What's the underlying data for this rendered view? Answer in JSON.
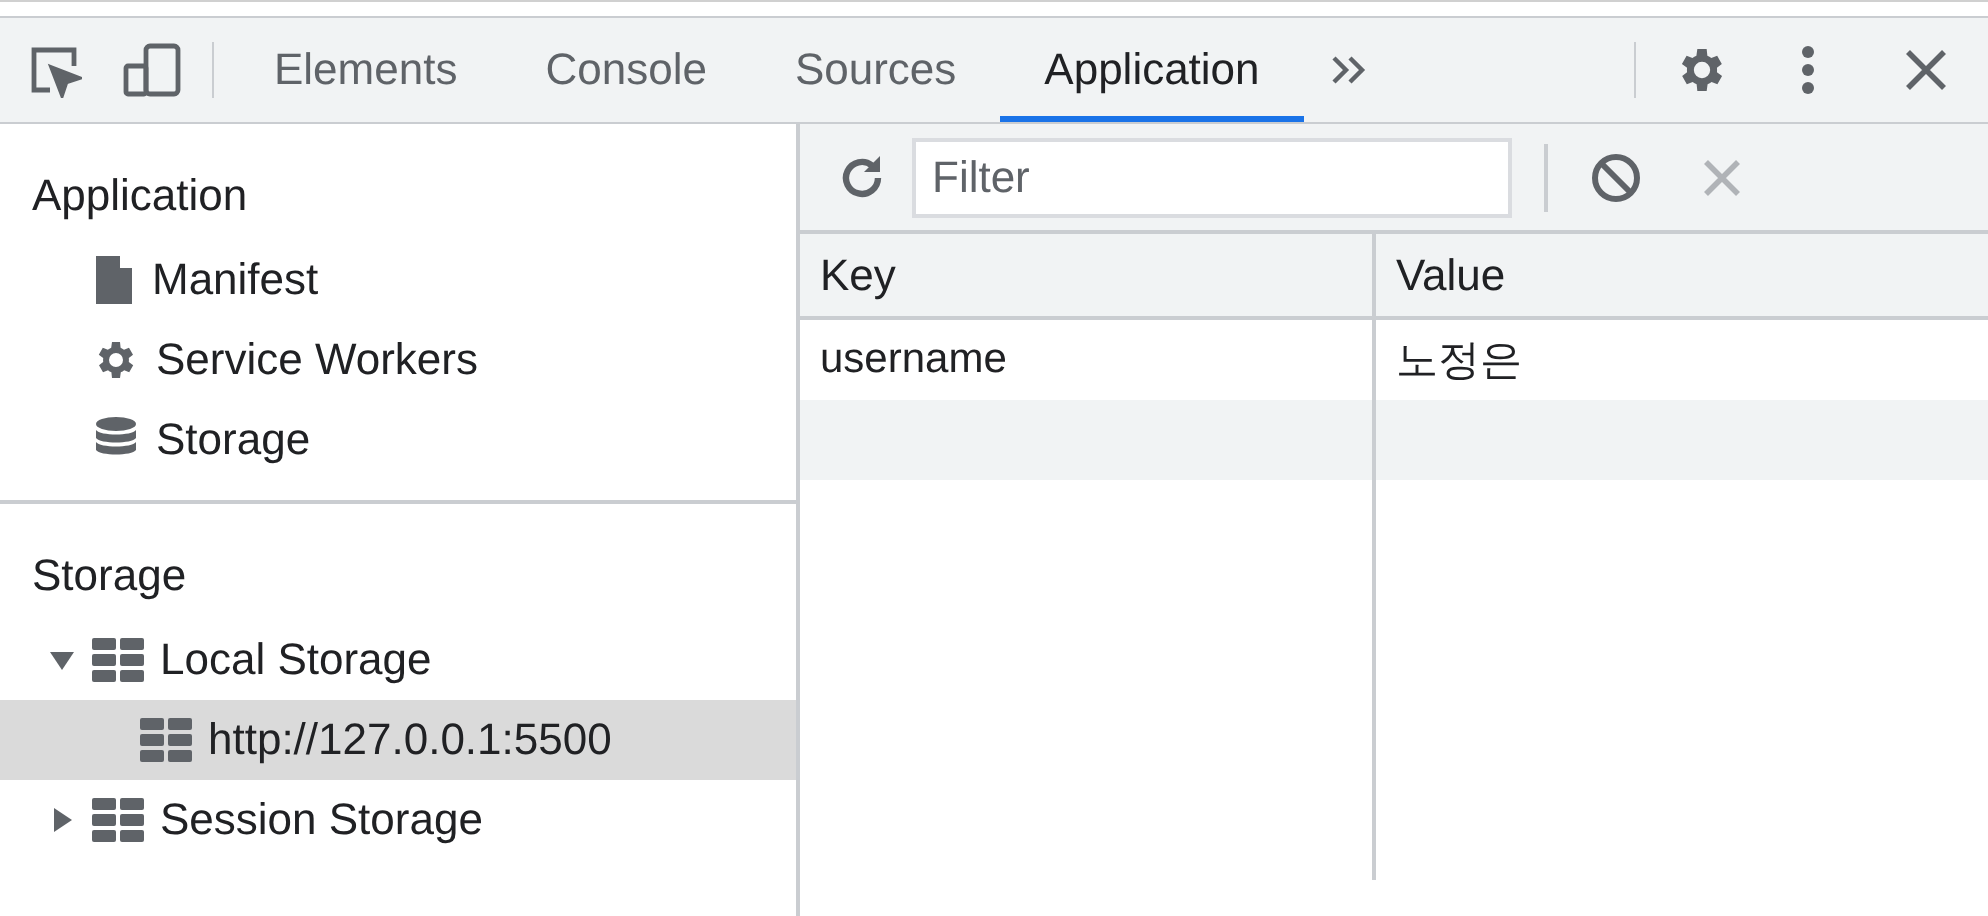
{
  "tabs": [
    {
      "label": "Elements",
      "selected": false
    },
    {
      "label": "Console",
      "selected": false
    },
    {
      "label": "Sources",
      "selected": false
    },
    {
      "label": "Application",
      "selected": true
    }
  ],
  "sidebar": {
    "sections": [
      {
        "title": "Application",
        "items": [
          {
            "label": "Manifest",
            "kind": "file",
            "selected": false
          },
          {
            "label": "Service Workers",
            "kind": "gear",
            "selected": false
          },
          {
            "label": "Storage",
            "kind": "database",
            "selected": false
          }
        ]
      },
      {
        "title": "Storage",
        "items": [
          {
            "label": "Local Storage",
            "kind": "grid",
            "selected": false,
            "expanded": true,
            "children": [
              {
                "label": "http://127.0.0.1:5500",
                "kind": "grid",
                "selected": true
              }
            ]
          },
          {
            "label": "Session Storage",
            "kind": "grid",
            "selected": false,
            "expanded": false
          }
        ]
      }
    ]
  },
  "filter": {
    "placeholder": "Filter"
  },
  "table": {
    "columns": [
      "Key",
      "Value"
    ],
    "rows": [
      [
        "username",
        "노정은"
      ]
    ]
  }
}
